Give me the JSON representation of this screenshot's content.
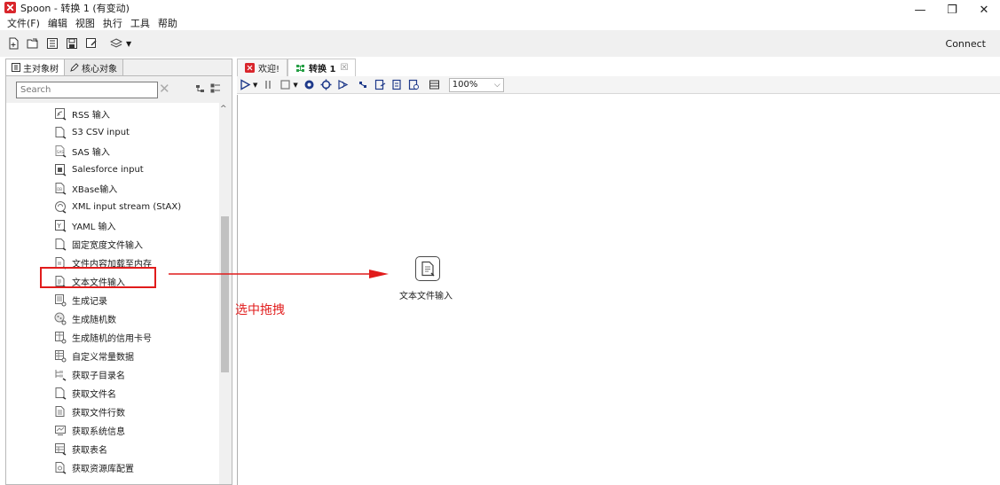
{
  "window": {
    "title": "Spoon - 转换 1 (有变动)",
    "controls": {
      "minimize": "—",
      "maximize": "❐",
      "close": "✕"
    }
  },
  "menu": [
    "文件(F)",
    "编辑",
    "视图",
    "执行",
    "工具",
    "帮助"
  ],
  "toolbar": {
    "connect_label": "Connect"
  },
  "left_panel": {
    "tabs": [
      {
        "label": "主对象树",
        "icon": "tree-icon"
      },
      {
        "label": "核心对象",
        "icon": "pencil-icon"
      }
    ],
    "search": {
      "placeholder": "Search",
      "clear": "✕"
    },
    "items": [
      {
        "label": "RSS 输入",
        "icon": "rss-icon"
      },
      {
        "label": "S3 CSV input",
        "icon": "file-icon"
      },
      {
        "label": "SAS 输入",
        "icon": "sas-icon"
      },
      {
        "label": "Salesforce input",
        "icon": "salesforce-icon"
      },
      {
        "label": "XBase输入",
        "icon": "xbase-icon"
      },
      {
        "label": "XML input stream (StAX)",
        "icon": "xml-icon"
      },
      {
        "label": "YAML 输入",
        "icon": "yaml-icon"
      },
      {
        "label": "固定宽度文件输入",
        "icon": "file-icon"
      },
      {
        "label": "文件内容加载至内存",
        "icon": "file-icon"
      },
      {
        "label": "文本文件输入",
        "icon": "text-file-icon"
      },
      {
        "label": "生成记录",
        "icon": "generate-rows-icon"
      },
      {
        "label": "生成随机数",
        "icon": "random-icon"
      },
      {
        "label": "生成随机的信用卡号",
        "icon": "card-icon"
      },
      {
        "label": "自定义常量数据",
        "icon": "constant-icon"
      },
      {
        "label": "获取子目录名",
        "icon": "folder-icon"
      },
      {
        "label": "获取文件名",
        "icon": "file-icon"
      },
      {
        "label": "获取文件行数",
        "icon": "rows-icon"
      },
      {
        "label": "获取系统信息",
        "icon": "system-icon"
      },
      {
        "label": "获取表名",
        "icon": "table-icon"
      },
      {
        "label": "获取资源库配置",
        "icon": "repo-icon"
      }
    ]
  },
  "editor": {
    "tabs": [
      {
        "label": "欢迎!",
        "icon": "spoon-icon"
      },
      {
        "label": "转换 1",
        "icon": "transform-icon",
        "close": "☒"
      }
    ],
    "zoom": "100%",
    "step": {
      "label": "文本文件输入",
      "icon": "text-file-icon"
    },
    "annotation": "选中拖拽"
  },
  "colors": {
    "highlight": "#e11c1c",
    "toolbar_bg": "#f0f0f0"
  }
}
